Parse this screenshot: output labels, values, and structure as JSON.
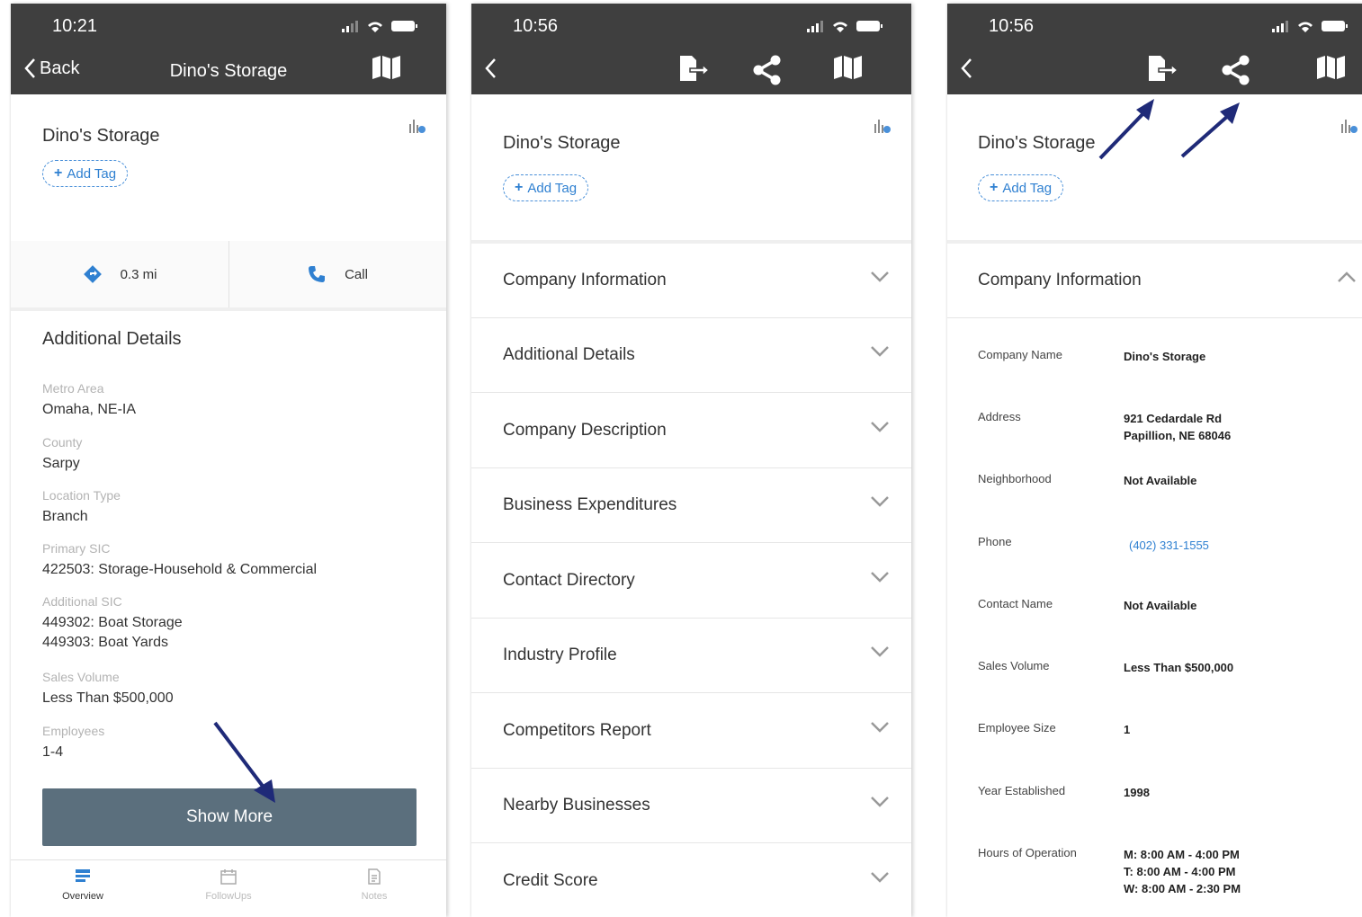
{
  "panel1": {
    "time": "10:21",
    "back_label": "Back",
    "nav_title": "Dino's Storage",
    "company_name": "Dino's Storage",
    "add_tag": "Add Tag",
    "distance": "0.3 mi",
    "call": "Call",
    "section_title": "Additional Details",
    "details": [
      {
        "label": "Metro Area",
        "value": "Omaha, NE-IA"
      },
      {
        "label": "County",
        "value": "Sarpy"
      },
      {
        "label": "Location Type",
        "value": "Branch"
      },
      {
        "label": "Primary SIC",
        "value": "422503: Storage-Household & Commercial"
      },
      {
        "label": "Additional SIC",
        "value": "449302: Boat Storage",
        "value2": "449303: Boat Yards"
      },
      {
        "label": "Sales Volume",
        "value": "Less Than $500,000"
      },
      {
        "label": "Employees",
        "value": "1-4"
      }
    ],
    "show_more": "Show More",
    "tabs": [
      "Overview",
      "FollowUps",
      "Notes"
    ]
  },
  "panel2": {
    "time": "10:56",
    "company_name": "Dino's Storage",
    "add_tag": "Add Tag",
    "sections": [
      "Company Information",
      "Additional Details",
      "Company Description",
      "Business Expenditures",
      "Contact Directory",
      "Industry Profile",
      "Competitors Report",
      "Nearby Businesses",
      "Credit Score"
    ]
  },
  "panel3": {
    "time": "10:56",
    "company_name": "Dino's Storage",
    "add_tag": "Add Tag",
    "section_title": "Company Information",
    "fields": [
      {
        "key": "Company Name",
        "value": "Dino's Storage"
      },
      {
        "key": "Address",
        "value": "921 Cedardale Rd",
        "value2": "Papillion, NE 68046"
      },
      {
        "key": "Neighborhood",
        "value": "Not Available"
      },
      {
        "key": "Phone",
        "value": "(402) 331-1555"
      },
      {
        "key": "Contact Name",
        "value": "Not Available"
      },
      {
        "key": "Sales Volume",
        "value": "Less Than $500,000"
      },
      {
        "key": "Employee Size",
        "value": "1"
      },
      {
        "key": "Year Established",
        "value": "1998"
      },
      {
        "key": "Hours of Operation",
        "value": "M: 8:00 AM - 4:00 PM",
        "value2": "T: 8:00 AM - 4:00 PM",
        "value3": "W: 8:00 AM - 2:30 PM"
      }
    ]
  },
  "colors": {
    "header": "#3f3f3f",
    "accent": "#2f80d1",
    "button": "#5b6f7d",
    "annotation_arrow": "#1f2a78"
  },
  "icons": [
    "chevron-left-icon",
    "map-icon",
    "export-icon",
    "share-icon",
    "directions-icon",
    "phone-icon",
    "chevron-down-icon",
    "chevron-up-icon",
    "overview-icon",
    "calendar-icon",
    "notes-icon"
  ]
}
